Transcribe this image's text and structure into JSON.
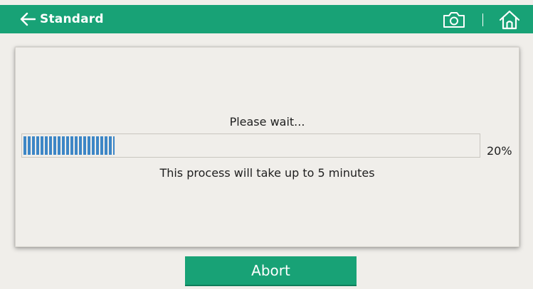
{
  "header": {
    "title": "Standard",
    "back_icon": "arrow-left-icon",
    "camera_icon": "camera-icon",
    "home_icon": "home-icon",
    "background_color": "#18a276"
  },
  "dialog": {
    "wait_message": "Please wait...",
    "progress": {
      "percent": 20,
      "label": "20%",
      "fill_color": "#3d86c6"
    },
    "duration_message": "This process will take up to 5 minutes"
  },
  "actions": {
    "abort_label": "Abort",
    "button_color": "#18a276"
  }
}
